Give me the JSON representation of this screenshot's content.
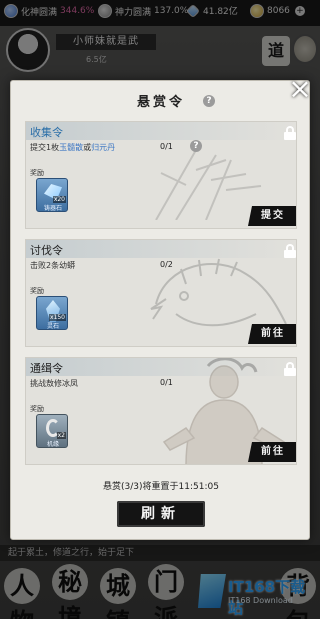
{
  "topbar": {
    "realm_label": "化神圆满",
    "realm_pct": "344.6%",
    "power_label": "神力圆满",
    "power_pct": "137.0%",
    "gems": "41.82亿",
    "coins": "8066"
  },
  "player": {
    "name": "小师妹就是武",
    "power": "6.5亿"
  },
  "scene_buttons": {
    "dao": "道"
  },
  "hint_text": "起于累土，修道之行，始于足下",
  "bottom_nav": [
    "人物",
    "秘境",
    "城镇",
    "门派",
    "背包"
  ],
  "watermark": {
    "brand": "IT168下载站",
    "sub": "IT168 Download"
  },
  "modal": {
    "title": "悬赏令",
    "close": "×",
    "help": "?",
    "reset_text": "悬赏(3/3)将重置于11:51:05",
    "refresh_label": "刷新",
    "cards": [
      {
        "title": "收集令",
        "desc_prefix": "提交1枚",
        "desc_item1": "玉髓散",
        "desc_or": "或",
        "desc_item2": "归元丹",
        "progress": "0/1",
        "reward_label": "奖励",
        "reward_name": "铸器石",
        "reward_count": "x20",
        "action": "提交"
      },
      {
        "title": "讨伐令",
        "desc": "击败2条幼蟒",
        "progress": "0/2",
        "reward_label": "奖励",
        "reward_name": "灵石",
        "reward_count": "x150",
        "action": "前往"
      },
      {
        "title": "通缉令",
        "desc": "挑战敖修冰凤",
        "progress": "0/1",
        "reward_label": "奖励",
        "reward_name": "机缘",
        "reward_count": "x2",
        "action": "前往"
      }
    ]
  }
}
